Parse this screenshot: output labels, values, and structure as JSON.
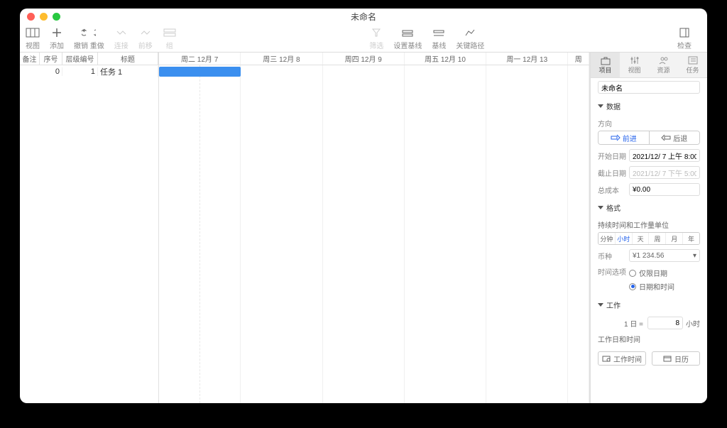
{
  "window": {
    "title": "未命名"
  },
  "toolbar": {
    "view": "视图",
    "add": "添加",
    "undo": "撤销",
    "redo": "重做",
    "chain": "连接",
    "move_up": "前移",
    "group": "组",
    "filter": "筛选",
    "set_baseline": "设置基线",
    "baseline": "基线",
    "critical_path": "关键路径",
    "inspector": "检查"
  },
  "outline": {
    "columns": {
      "note": "备注",
      "seq": "序号",
      "outline_num": "层级编号",
      "title": "标题"
    },
    "rows": [
      {
        "seq": "0",
        "outline_num": "1",
        "title": "任务 1"
      }
    ]
  },
  "timeline": {
    "days": [
      "周二 12月 7",
      "周三 12月 8",
      "周四 12月 9",
      "周五 12月 10",
      "周一 12月 13",
      "周"
    ]
  },
  "inspector": {
    "tabs": {
      "project": "项目",
      "view": "视图",
      "resources": "资源",
      "task": "任务"
    },
    "title_value": "未命名",
    "sections": {
      "data": "数据",
      "format": "格式",
      "work": "工作"
    },
    "data": {
      "direction_label": "方向",
      "forward": "前进",
      "backward": "后退",
      "start_date_label": "开始日期",
      "start_date_value": "2021/12/ 7 上午 8:00",
      "end_date_label": "截止日期",
      "end_date_value": "2021/12/ 7 下午 5:00",
      "total_cost_label": "总成本",
      "total_cost_value": "¥0.00"
    },
    "format": {
      "duration_unit_label": "持续时间和工作量单位",
      "units": [
        "分钟",
        "小时",
        "天",
        "周",
        "月",
        "年"
      ],
      "currency_label": "币种",
      "currency_value": "¥1 234.56",
      "time_option_label": "时间选项",
      "date_only": "仅限日期",
      "date_and_time": "日期和时间"
    },
    "work": {
      "one_day_eq": "1 日 =",
      "hours_value": "8",
      "hours_unit": "小时",
      "workdays_label": "工作日和时间",
      "work_time_btn": "工作时间",
      "calendar_btn": "日历"
    }
  }
}
